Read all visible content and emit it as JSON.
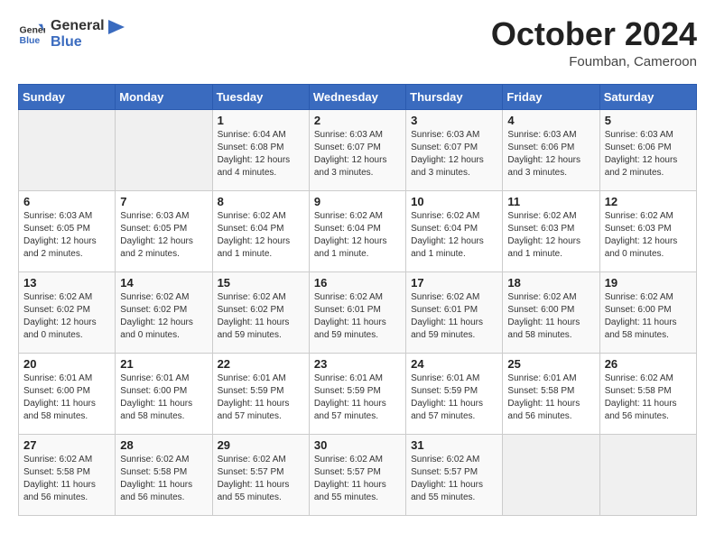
{
  "header": {
    "logo_line1": "General",
    "logo_line2": "Blue",
    "month": "October 2024",
    "location": "Foumban, Cameroon"
  },
  "weekdays": [
    "Sunday",
    "Monday",
    "Tuesday",
    "Wednesday",
    "Thursday",
    "Friday",
    "Saturday"
  ],
  "weeks": [
    [
      {
        "day": "",
        "info": ""
      },
      {
        "day": "",
        "info": ""
      },
      {
        "day": "1",
        "info": "Sunrise: 6:04 AM\nSunset: 6:08 PM\nDaylight: 12 hours\nand 4 minutes."
      },
      {
        "day": "2",
        "info": "Sunrise: 6:03 AM\nSunset: 6:07 PM\nDaylight: 12 hours\nand 3 minutes."
      },
      {
        "day": "3",
        "info": "Sunrise: 6:03 AM\nSunset: 6:07 PM\nDaylight: 12 hours\nand 3 minutes."
      },
      {
        "day": "4",
        "info": "Sunrise: 6:03 AM\nSunset: 6:06 PM\nDaylight: 12 hours\nand 3 minutes."
      },
      {
        "day": "5",
        "info": "Sunrise: 6:03 AM\nSunset: 6:06 PM\nDaylight: 12 hours\nand 2 minutes."
      }
    ],
    [
      {
        "day": "6",
        "info": "Sunrise: 6:03 AM\nSunset: 6:05 PM\nDaylight: 12 hours\nand 2 minutes."
      },
      {
        "day": "7",
        "info": "Sunrise: 6:03 AM\nSunset: 6:05 PM\nDaylight: 12 hours\nand 2 minutes."
      },
      {
        "day": "8",
        "info": "Sunrise: 6:02 AM\nSunset: 6:04 PM\nDaylight: 12 hours\nand 1 minute."
      },
      {
        "day": "9",
        "info": "Sunrise: 6:02 AM\nSunset: 6:04 PM\nDaylight: 12 hours\nand 1 minute."
      },
      {
        "day": "10",
        "info": "Sunrise: 6:02 AM\nSunset: 6:04 PM\nDaylight: 12 hours\nand 1 minute."
      },
      {
        "day": "11",
        "info": "Sunrise: 6:02 AM\nSunset: 6:03 PM\nDaylight: 12 hours\nand 1 minute."
      },
      {
        "day": "12",
        "info": "Sunrise: 6:02 AM\nSunset: 6:03 PM\nDaylight: 12 hours\nand 0 minutes."
      }
    ],
    [
      {
        "day": "13",
        "info": "Sunrise: 6:02 AM\nSunset: 6:02 PM\nDaylight: 12 hours\nand 0 minutes."
      },
      {
        "day": "14",
        "info": "Sunrise: 6:02 AM\nSunset: 6:02 PM\nDaylight: 12 hours\nand 0 minutes."
      },
      {
        "day": "15",
        "info": "Sunrise: 6:02 AM\nSunset: 6:02 PM\nDaylight: 11 hours\nand 59 minutes."
      },
      {
        "day": "16",
        "info": "Sunrise: 6:02 AM\nSunset: 6:01 PM\nDaylight: 11 hours\nand 59 minutes."
      },
      {
        "day": "17",
        "info": "Sunrise: 6:02 AM\nSunset: 6:01 PM\nDaylight: 11 hours\nand 59 minutes."
      },
      {
        "day": "18",
        "info": "Sunrise: 6:02 AM\nSunset: 6:00 PM\nDaylight: 11 hours\nand 58 minutes."
      },
      {
        "day": "19",
        "info": "Sunrise: 6:02 AM\nSunset: 6:00 PM\nDaylight: 11 hours\nand 58 minutes."
      }
    ],
    [
      {
        "day": "20",
        "info": "Sunrise: 6:01 AM\nSunset: 6:00 PM\nDaylight: 11 hours\nand 58 minutes."
      },
      {
        "day": "21",
        "info": "Sunrise: 6:01 AM\nSunset: 6:00 PM\nDaylight: 11 hours\nand 58 minutes."
      },
      {
        "day": "22",
        "info": "Sunrise: 6:01 AM\nSunset: 5:59 PM\nDaylight: 11 hours\nand 57 minutes."
      },
      {
        "day": "23",
        "info": "Sunrise: 6:01 AM\nSunset: 5:59 PM\nDaylight: 11 hours\nand 57 minutes."
      },
      {
        "day": "24",
        "info": "Sunrise: 6:01 AM\nSunset: 5:59 PM\nDaylight: 11 hours\nand 57 minutes."
      },
      {
        "day": "25",
        "info": "Sunrise: 6:01 AM\nSunset: 5:58 PM\nDaylight: 11 hours\nand 56 minutes."
      },
      {
        "day": "26",
        "info": "Sunrise: 6:02 AM\nSunset: 5:58 PM\nDaylight: 11 hours\nand 56 minutes."
      }
    ],
    [
      {
        "day": "27",
        "info": "Sunrise: 6:02 AM\nSunset: 5:58 PM\nDaylight: 11 hours\nand 56 minutes."
      },
      {
        "day": "28",
        "info": "Sunrise: 6:02 AM\nSunset: 5:58 PM\nDaylight: 11 hours\nand 56 minutes."
      },
      {
        "day": "29",
        "info": "Sunrise: 6:02 AM\nSunset: 5:57 PM\nDaylight: 11 hours\nand 55 minutes."
      },
      {
        "day": "30",
        "info": "Sunrise: 6:02 AM\nSunset: 5:57 PM\nDaylight: 11 hours\nand 55 minutes."
      },
      {
        "day": "31",
        "info": "Sunrise: 6:02 AM\nSunset: 5:57 PM\nDaylight: 11 hours\nand 55 minutes."
      },
      {
        "day": "",
        "info": ""
      },
      {
        "day": "",
        "info": ""
      }
    ]
  ]
}
